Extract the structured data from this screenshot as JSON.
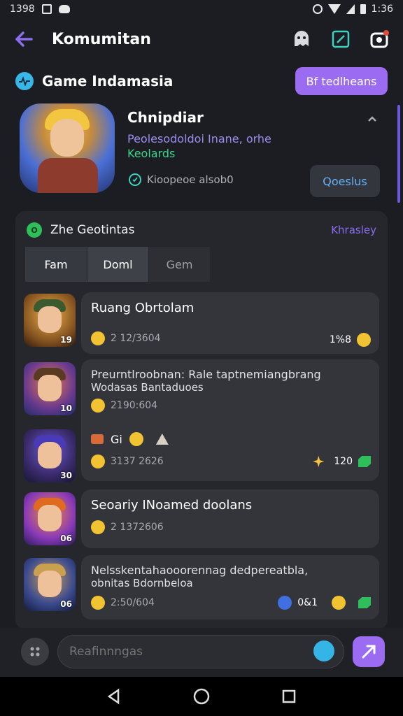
{
  "status_bar": {
    "time_left": "1398",
    "time_right": "1:36"
  },
  "app_bar": {
    "title": "Komumitan"
  },
  "group": {
    "name": "Game Indamasia",
    "join_label": "Bf tedlheans"
  },
  "profile": {
    "name": "Chnipdiar",
    "desc_line1": "Peolesodoldoi Inane, orhe",
    "desc_line2": "Keolards",
    "status": "Kioopeoe alsob0",
    "details_label": "Qoeslus"
  },
  "panel": {
    "title": "Zhe Geotintas",
    "online_badge": "O",
    "link": "Khrasley",
    "tabs": [
      "Fam",
      "Doml",
      "Gem"
    ]
  },
  "messages": [
    {
      "title": "Ruang Obrtolam",
      "body": "",
      "time": "2 12/3604",
      "level": "19",
      "right": "1%8"
    },
    {
      "title": "Preurntlroobnan: Rale taptnemiangbrang",
      "body": "Wodasas Bantaduoes",
      "time": "2190:604",
      "level": "10",
      "right": ""
    },
    {
      "title": "Gi",
      "body": "",
      "time": "3137 2626",
      "level": "30",
      "right": "120"
    },
    {
      "title": "Seoariy INoamed doolans",
      "body": "",
      "time": "2 1372606",
      "level": "06",
      "right": ""
    },
    {
      "title": "Nelsskentahaooorennag dedpereatbla,",
      "body": "obnitas Bdornbeloa",
      "time": "2:50/604",
      "level": "06",
      "right": "0&1"
    }
  ],
  "input": {
    "placeholder": "Reafinnngas"
  },
  "colors": {
    "accent": "#9b6bf2",
    "background": "#1c1d22",
    "panel": "#26272d",
    "online": "#2fbf5a"
  }
}
